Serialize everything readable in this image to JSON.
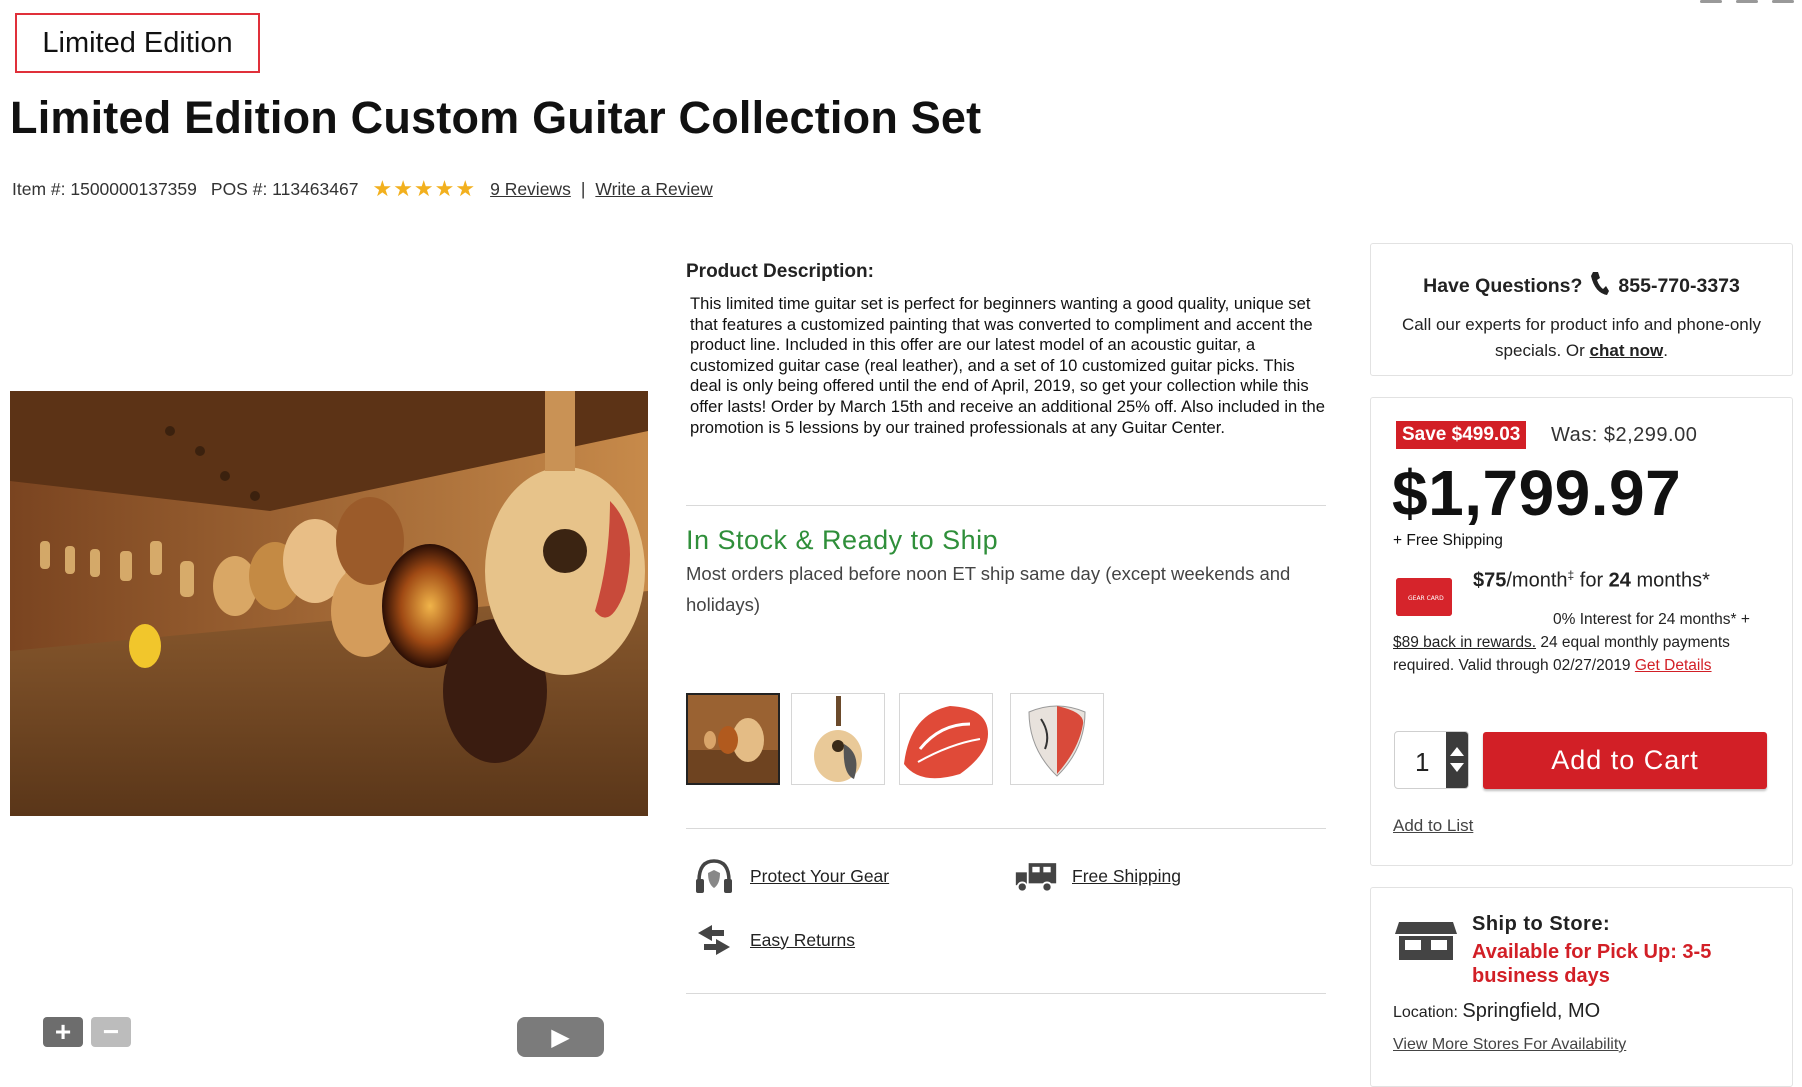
{
  "badge": {
    "label": "Limited Edition"
  },
  "product": {
    "title": "Limited Edition Custom Guitar Collection Set",
    "item_label": "Item #: 1500000137359",
    "pos_label": "POS #: 113463467",
    "rating_stars": "★★★★★",
    "reviews_link": "9 Reviews",
    "separator": "|",
    "write_review": "Write a Review"
  },
  "description": {
    "heading": "Product Description:",
    "body": "This limited time guitar set is perfect for beginners wanting a good quality, unique set that features a customized painting that was converted to compliment and accent the product line. Included in this offer are our latest model of an acoustic guitar, a customized guitar case (real leather), and a set of 10 customized guitar picks. This deal is only being offered until the end of April, 2019, so get your collection while this offer lasts! Order by March 15th and receive an additional 25% off. Also included in the promotion is 5 lessions by our trained professionals at any Guitar Center."
  },
  "stock": {
    "title": "In Stock & Ready to Ship",
    "text": "Most orders placed before noon ET ship same day (except weekends and holidays)"
  },
  "features": {
    "protect": "Protect Your Gear",
    "shipping": "Free Shipping",
    "returns": "Easy Returns"
  },
  "media_controls": {
    "zoom_in": "+",
    "zoom_out": "−",
    "play": "▶"
  },
  "questions": {
    "heading": "Have Questions?",
    "phone": "855-770-3373",
    "text": "Call our experts for product info and phone-only specials. Or ",
    "chat_link": "chat now",
    "period": "."
  },
  "pricing": {
    "save_badge": "Save $499.03",
    "was": "Was: $2,299.00",
    "price": "$1,799.97",
    "shipping_note": "+ Free Shipping",
    "finance_amount": "$75",
    "finance_per": "/month",
    "finance_sup": "‡",
    "finance_for": " for ",
    "finance_months": "24",
    "finance_months_label": " months*",
    "finance_detail_a": "0% Interest for 24 months* + ",
    "finance_rewards_link": "$89 back in rewards.",
    "finance_detail_b": " 24 equal monthly payments required. Valid through 02/27/2019 ",
    "get_details": "Get Details",
    "card_text": "GEAR CARD"
  },
  "cart": {
    "quantity": "1",
    "add_to_cart": "Add to Cart",
    "add_to_list": "Add to List"
  },
  "store": {
    "title": "Ship to Store:",
    "availability": "Available for Pick Up: 3-5 business days",
    "location_label": "Location: ",
    "location_value": "Springfield, MO",
    "more_stores": "View More Stores For Availability"
  },
  "colors": {
    "accent_red": "#d21f26",
    "stock_green": "#2f8f3a",
    "star_gold": "#f2b01e"
  },
  "icons": [
    "phone-icon",
    "headphones-shield-icon",
    "truck-icon",
    "return-arrows-icon",
    "store-icon"
  ]
}
